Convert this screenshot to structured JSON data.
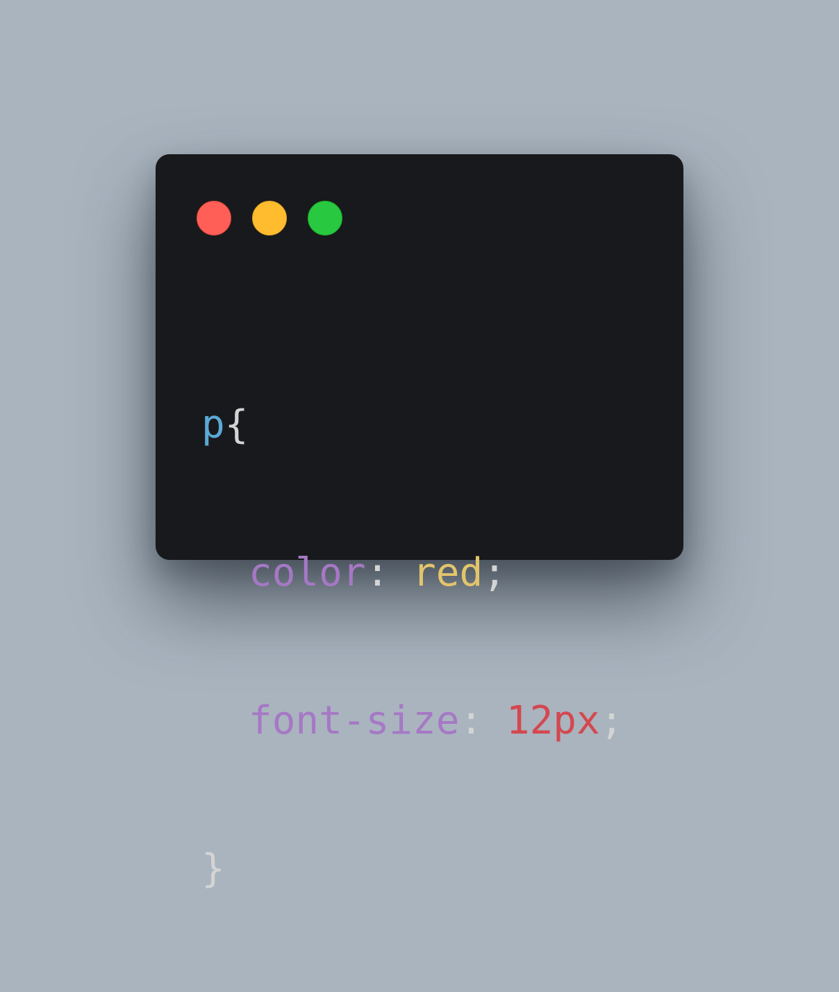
{
  "window": {
    "controls": [
      {
        "name": "close",
        "color": "#ff5f57"
      },
      {
        "name": "minimize",
        "color": "#febc2e"
      },
      {
        "name": "maximize",
        "color": "#28c840"
      }
    ]
  },
  "code": {
    "selector": "p",
    "open_brace": "{",
    "declarations": [
      {
        "property": "color",
        "colon": ":",
        "value": "red",
        "semicolon": ";"
      },
      {
        "property": "font-size",
        "colon": ":",
        "value": "12px",
        "semicolon": ";"
      }
    ],
    "close_brace": "}"
  },
  "colors": {
    "background": "#a9b4bf",
    "window": "#18191c",
    "selector": "#5aa9d6",
    "property": "#a678c5",
    "keyword_value": "#e2c56b",
    "number_value": "#d5474f",
    "punctuation": "#d4d4d4"
  }
}
